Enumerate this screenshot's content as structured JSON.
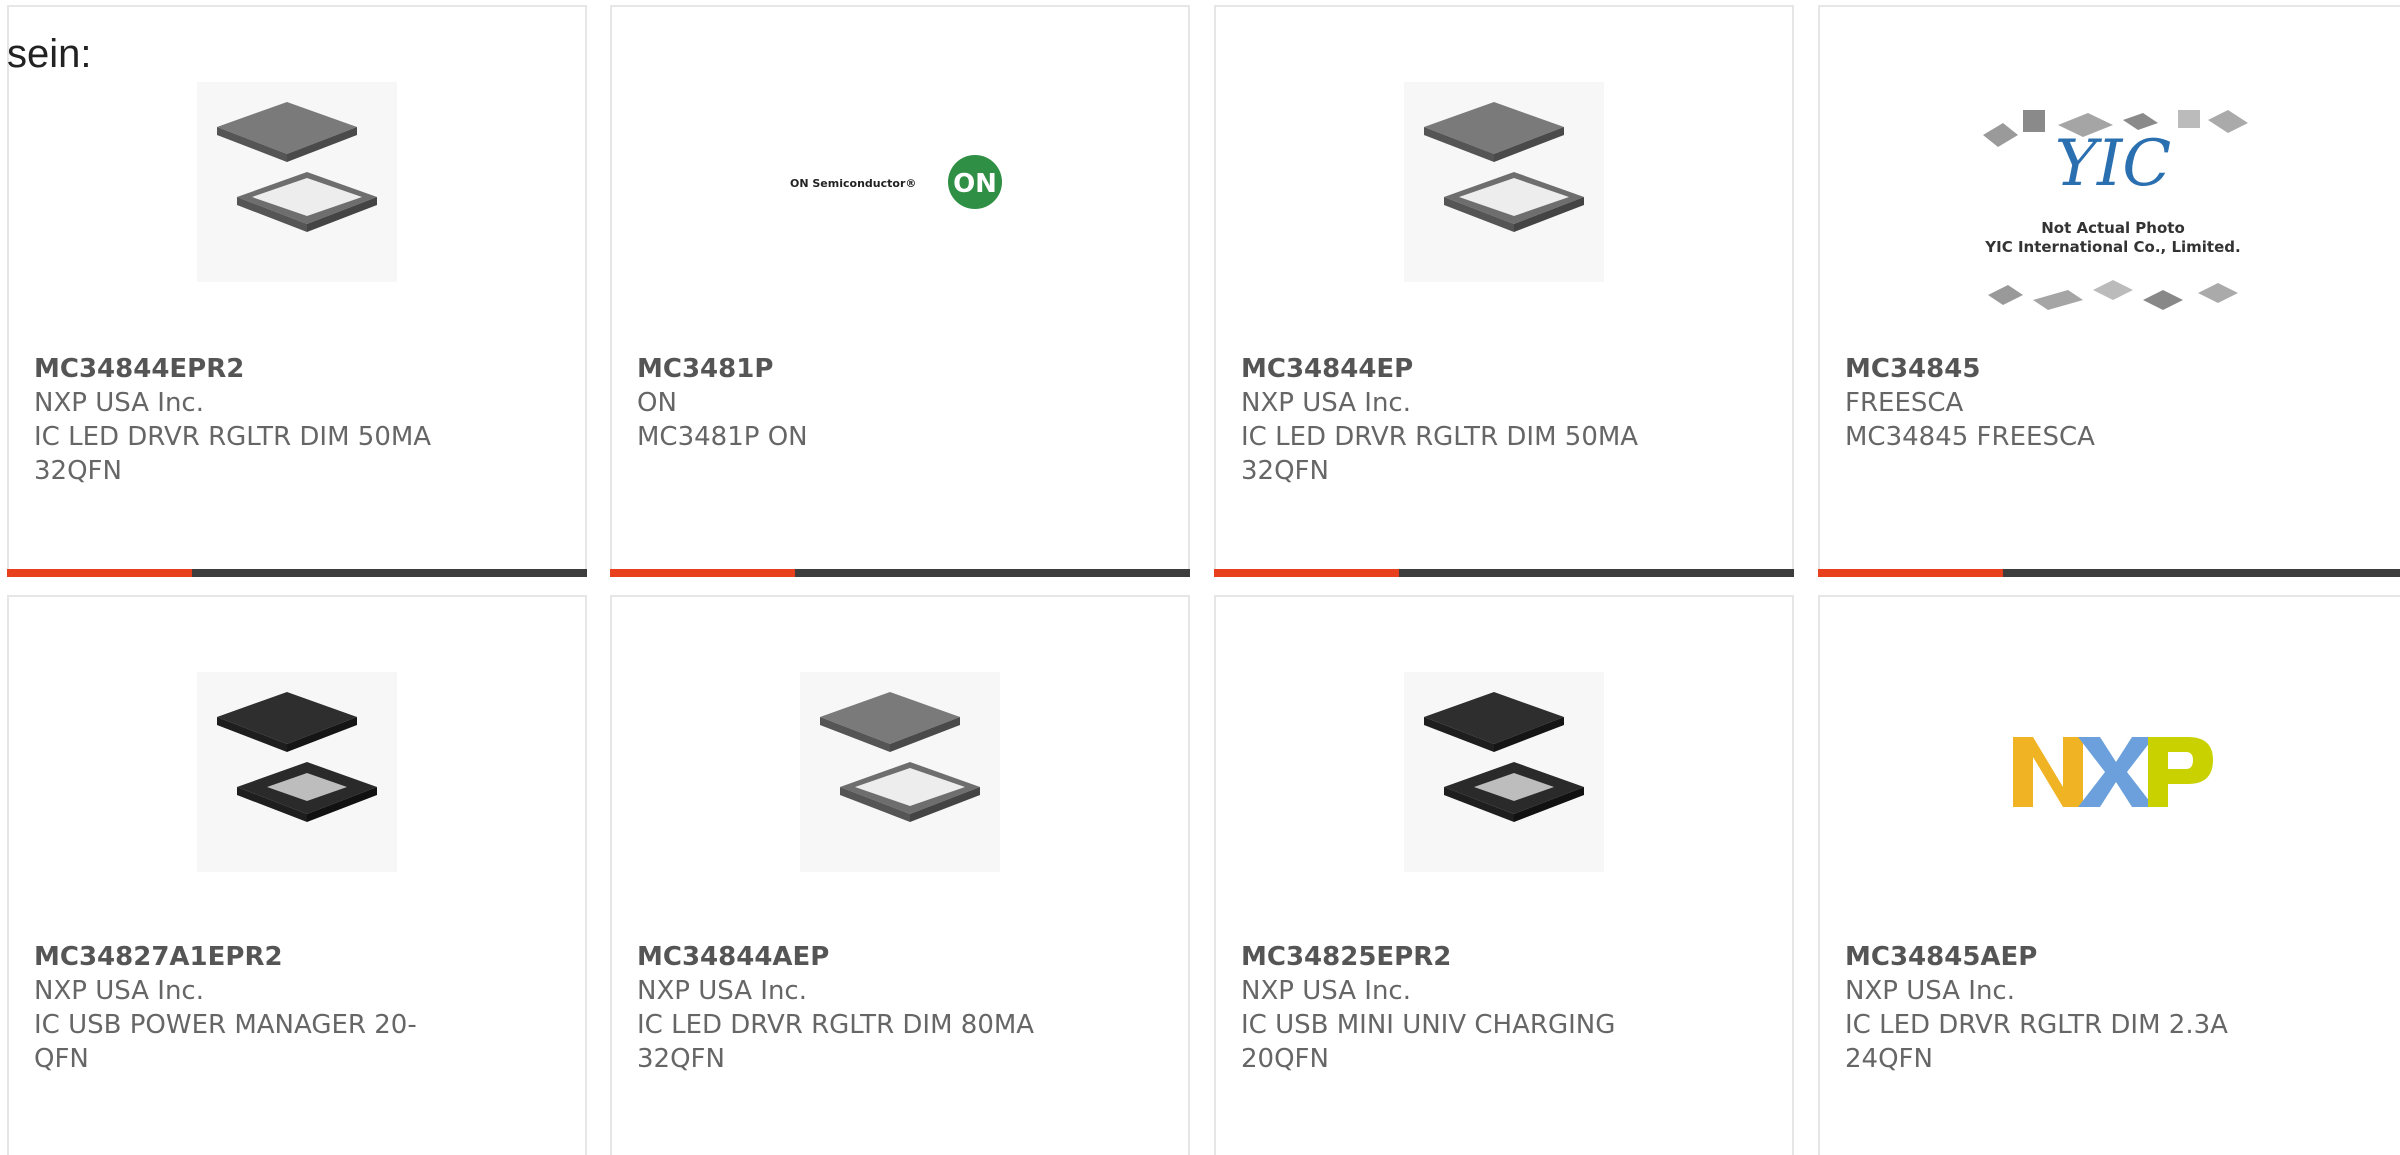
{
  "heading": "sein:",
  "colors": {
    "accent": "#e8401c",
    "bar": "#3d3d3d",
    "border": "#e6e6e6",
    "text": "#666666"
  },
  "products": [
    {
      "part": "MC34844EPR2",
      "manufacturer": "NXP USA Inc.",
      "description": "IC LED DRVR RGLTR DIM 50MA 32QFN",
      "image": "qfn-chip-image"
    },
    {
      "part": "MC3481P",
      "manufacturer": "ON",
      "description": "MC3481P ON",
      "image": "on-semiconductor-logo",
      "logo_text": "ON Semiconductor®",
      "logo_badge": "ON"
    },
    {
      "part": "MC34844EP",
      "manufacturer": "NXP USA Inc.",
      "description": "IC LED DRVR RGLTR DIM 50MA 32QFN",
      "image": "qfn-chip-image"
    },
    {
      "part": "MC34845",
      "manufacturer": "FREESCA",
      "description": "MC34845 FREESCA",
      "image": "yic-placeholder-image",
      "placeholder_line1": "Not Actual Photo",
      "placeholder_line2": "YIC International Co., Limited."
    },
    {
      "part": "MC34827A1EPR2",
      "manufacturer": "NXP USA Inc.",
      "description": "IC USB POWER MANAGER 20-QFN",
      "image": "qfn-chip-dark-image"
    },
    {
      "part": "MC34844AEP",
      "manufacturer": "NXP USA Inc.",
      "description": "IC LED DRVR RGLTR DIM 80MA 32QFN",
      "image": "qfn-chip-image"
    },
    {
      "part": "MC34825EPR2",
      "manufacturer": "NXP USA Inc.",
      "description": "IC USB MINI UNIV CHARGING 20QFN",
      "image": "qfn-chip-dark-image"
    },
    {
      "part": "MC34845AEP",
      "manufacturer": "NXP USA Inc.",
      "description": "IC LED DRVR RGLTR DIM 2.3A 24QFN",
      "image": "nxp-logo"
    }
  ]
}
